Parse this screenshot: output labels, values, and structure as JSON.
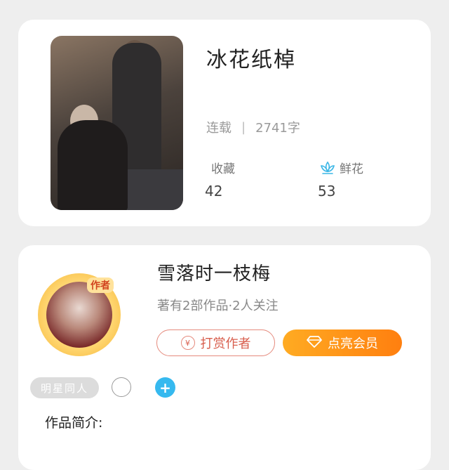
{
  "book": {
    "title": "冰花纸棹",
    "status": "连载",
    "word_count": "2741字",
    "favorites_label": "收藏",
    "favorites_count": "42",
    "flowers_label": "鲜花",
    "flowers_count": "53",
    "flower_icon": "lotus-icon",
    "accent_color": "#3cb7e6"
  },
  "author": {
    "name": "雪落时一枝梅",
    "meta": "著有2部作品·2人关注",
    "badge": "作者",
    "reward_label": "打赏作者",
    "reward_icon": "yen-coin-icon",
    "vip_label": "点亮会员",
    "vip_icon": "diamond-icon",
    "tag_label": "明星同人",
    "intro_label": "作品简介:"
  },
  "colors": {
    "vip_gradient_start": "#ffab22",
    "vip_gradient_end": "#ff7f0f",
    "reward_border": "#e58a7d",
    "add_button": "#36b9ef"
  }
}
